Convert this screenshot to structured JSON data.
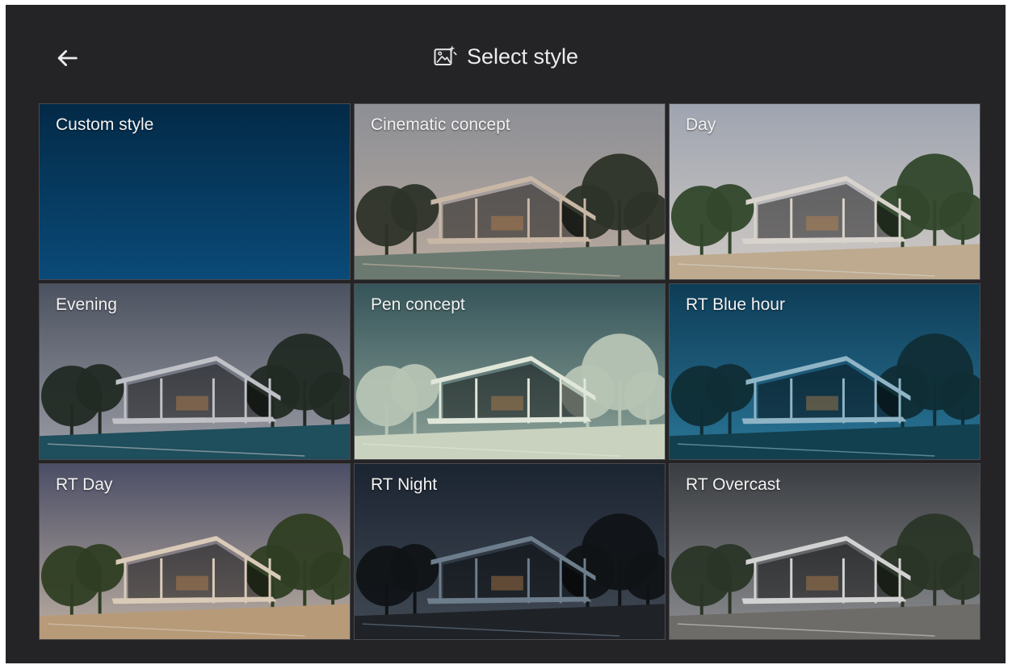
{
  "header": {
    "title": "Select style",
    "back_icon": "arrow-left-icon",
    "title_icon": "image-sparkle-icon"
  },
  "styles": [
    {
      "label": "Custom style",
      "theme": "custom",
      "sky": [
        "#032a47",
        "#0a4a78"
      ],
      "ground": "#0a4a78",
      "house": "#ffffff",
      "tree": "#000000"
    },
    {
      "label": "Cinematic concept",
      "theme": "photo",
      "sky": [
        "#8d8f96",
        "#b8a99d"
      ],
      "ground": "#6b7a70",
      "house": "#c9b7a6",
      "tree": "#2d3328"
    },
    {
      "label": "Day",
      "theme": "photo",
      "sky": [
        "#9ea4b0",
        "#cfc9c4"
      ],
      "ground": "#bdaa8f",
      "house": "#d8d3cc",
      "tree": "#32472b"
    },
    {
      "label": "Evening",
      "theme": "photo",
      "sky": [
        "#4c5260",
        "#9b9da5"
      ],
      "ground": "#1f4e5c",
      "house": "#bfc1c6",
      "tree": "#222a24"
    },
    {
      "label": "Pen concept",
      "theme": "photo",
      "sky": [
        "#36555a",
        "#8ea399"
      ],
      "ground": "#c9d2bf",
      "house": "#e0e6d9",
      "tree": "#b6c4b4"
    },
    {
      "label": "RT Blue hour",
      "theme": "photo",
      "sky": [
        "#0e3d57",
        "#2a7597"
      ],
      "ground": "#12404f",
      "house": "#8fb4c6",
      "tree": "#102d35"
    },
    {
      "label": "RT Day",
      "theme": "photo",
      "sky": [
        "#4b4e66",
        "#bcaea2"
      ],
      "ground": "#b79a78",
      "house": "#d9cbb8",
      "tree": "#2f3e23"
    },
    {
      "label": "RT Night",
      "theme": "photo",
      "sky": [
        "#1b2431",
        "#414a54"
      ],
      "ground": "#1f2227",
      "house": "#6d7d8c",
      "tree": "#101316"
    },
    {
      "label": "RT Overcast",
      "theme": "photo",
      "sky": [
        "#3a3d41",
        "#8c8d90"
      ],
      "ground": "#6e6c68",
      "house": "#d2d2d2",
      "tree": "#2a3527"
    }
  ]
}
